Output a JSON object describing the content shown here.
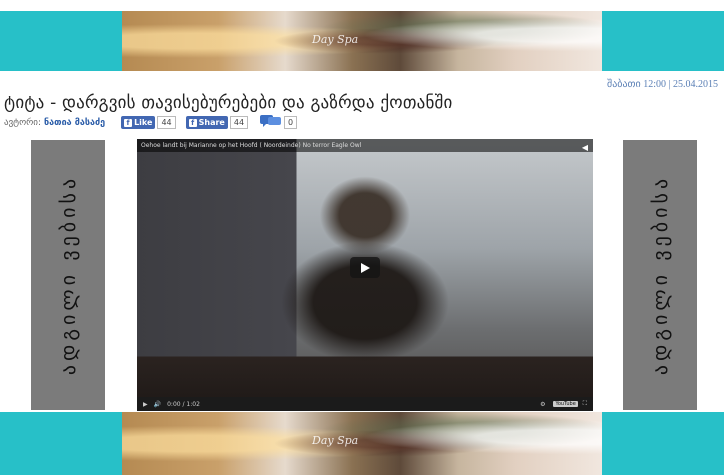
{
  "banner": {
    "caption": "Day Spa"
  },
  "meta": {
    "date_time": "შაბათი 12:00 | 25.04.2015"
  },
  "article": {
    "title": "ტიტა - დარგვის თავისებურებები და გაზრდა ქოთანში",
    "author_label": "ავტორი:",
    "author_name": "ნათია მასაძე"
  },
  "share": {
    "fb_like_label": "Like",
    "fb_like_count": "44",
    "fb_share_label": "Share",
    "fb_share_count": "44",
    "comment_count": "0"
  },
  "side_ad": {
    "text": "ადგილი ვებისა"
  },
  "video": {
    "title": "Oehoe landt bij Marianne op het Hoofd ( Noordeinde) No terror Eagle Owl",
    "time": "0:00 / 1:02",
    "logo": "YouTube"
  },
  "colors": {
    "banner_bg": "#27c0c8",
    "fb_blue": "#4267b2",
    "side_ad_bg": "#7b7b7b"
  },
  "icons": [
    "facebook-icon",
    "comment-bubble-icon",
    "play-icon",
    "volume-icon",
    "settings-icon",
    "fullscreen-icon",
    "share-icon"
  ]
}
